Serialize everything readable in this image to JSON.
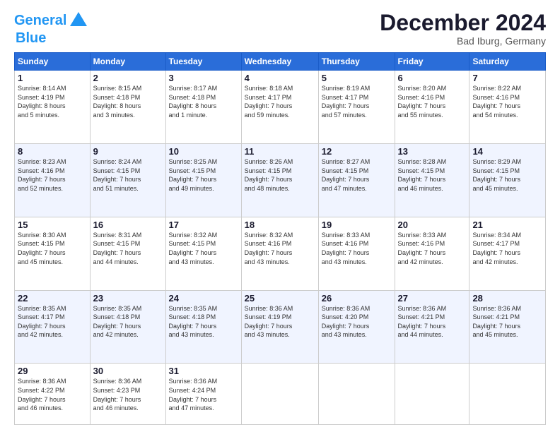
{
  "logo": {
    "line1": "General",
    "line2": "Blue"
  },
  "title": "December 2024",
  "subtitle": "Bad Iburg, Germany",
  "days_of_week": [
    "Sunday",
    "Monday",
    "Tuesday",
    "Wednesday",
    "Thursday",
    "Friday",
    "Saturday"
  ],
  "weeks": [
    [
      {
        "day": "1",
        "sunrise": "8:14 AM",
        "sunset": "4:19 PM",
        "daylight": "8 hours and 5 minutes."
      },
      {
        "day": "2",
        "sunrise": "8:15 AM",
        "sunset": "4:18 PM",
        "daylight": "8 hours and 3 minutes."
      },
      {
        "day": "3",
        "sunrise": "8:17 AM",
        "sunset": "4:18 PM",
        "daylight": "8 hours and 1 minute."
      },
      {
        "day": "4",
        "sunrise": "8:18 AM",
        "sunset": "4:17 PM",
        "daylight": "7 hours and 59 minutes."
      },
      {
        "day": "5",
        "sunrise": "8:19 AM",
        "sunset": "4:17 PM",
        "daylight": "7 hours and 57 minutes."
      },
      {
        "day": "6",
        "sunrise": "8:20 AM",
        "sunset": "4:16 PM",
        "daylight": "7 hours and 55 minutes."
      },
      {
        "day": "7",
        "sunrise": "8:22 AM",
        "sunset": "4:16 PM",
        "daylight": "7 hours and 54 minutes."
      }
    ],
    [
      {
        "day": "8",
        "sunrise": "8:23 AM",
        "sunset": "4:16 PM",
        "daylight": "7 hours and 52 minutes."
      },
      {
        "day": "9",
        "sunrise": "8:24 AM",
        "sunset": "4:15 PM",
        "daylight": "7 hours and 51 minutes."
      },
      {
        "day": "10",
        "sunrise": "8:25 AM",
        "sunset": "4:15 PM",
        "daylight": "7 hours and 49 minutes."
      },
      {
        "day": "11",
        "sunrise": "8:26 AM",
        "sunset": "4:15 PM",
        "daylight": "7 hours and 48 minutes."
      },
      {
        "day": "12",
        "sunrise": "8:27 AM",
        "sunset": "4:15 PM",
        "daylight": "7 hours and 47 minutes."
      },
      {
        "day": "13",
        "sunrise": "8:28 AM",
        "sunset": "4:15 PM",
        "daylight": "7 hours and 46 minutes."
      },
      {
        "day": "14",
        "sunrise": "8:29 AM",
        "sunset": "4:15 PM",
        "daylight": "7 hours and 45 minutes."
      }
    ],
    [
      {
        "day": "15",
        "sunrise": "8:30 AM",
        "sunset": "4:15 PM",
        "daylight": "7 hours and 45 minutes."
      },
      {
        "day": "16",
        "sunrise": "8:31 AM",
        "sunset": "4:15 PM",
        "daylight": "7 hours and 44 minutes."
      },
      {
        "day": "17",
        "sunrise": "8:32 AM",
        "sunset": "4:15 PM",
        "daylight": "7 hours and 43 minutes."
      },
      {
        "day": "18",
        "sunrise": "8:32 AM",
        "sunset": "4:16 PM",
        "daylight": "7 hours and 43 minutes."
      },
      {
        "day": "19",
        "sunrise": "8:33 AM",
        "sunset": "4:16 PM",
        "daylight": "7 hours and 43 minutes."
      },
      {
        "day": "20",
        "sunrise": "8:33 AM",
        "sunset": "4:16 PM",
        "daylight": "7 hours and 42 minutes."
      },
      {
        "day": "21",
        "sunrise": "8:34 AM",
        "sunset": "4:17 PM",
        "daylight": "7 hours and 42 minutes."
      }
    ],
    [
      {
        "day": "22",
        "sunrise": "8:35 AM",
        "sunset": "4:17 PM",
        "daylight": "7 hours and 42 minutes."
      },
      {
        "day": "23",
        "sunrise": "8:35 AM",
        "sunset": "4:18 PM",
        "daylight": "7 hours and 42 minutes."
      },
      {
        "day": "24",
        "sunrise": "8:35 AM",
        "sunset": "4:18 PM",
        "daylight": "7 hours and 43 minutes."
      },
      {
        "day": "25",
        "sunrise": "8:36 AM",
        "sunset": "4:19 PM",
        "daylight": "7 hours and 43 minutes."
      },
      {
        "day": "26",
        "sunrise": "8:36 AM",
        "sunset": "4:20 PM",
        "daylight": "7 hours and 43 minutes."
      },
      {
        "day": "27",
        "sunrise": "8:36 AM",
        "sunset": "4:21 PM",
        "daylight": "7 hours and 44 minutes."
      },
      {
        "day": "28",
        "sunrise": "8:36 AM",
        "sunset": "4:21 PM",
        "daylight": "7 hours and 45 minutes."
      }
    ],
    [
      {
        "day": "29",
        "sunrise": "8:36 AM",
        "sunset": "4:22 PM",
        "daylight": "7 hours and 46 minutes."
      },
      {
        "day": "30",
        "sunrise": "8:36 AM",
        "sunset": "4:23 PM",
        "daylight": "7 hours and 46 minutes."
      },
      {
        "day": "31",
        "sunrise": "8:36 AM",
        "sunset": "4:24 PM",
        "daylight": "7 hours and 47 minutes."
      },
      null,
      null,
      null,
      null
    ]
  ]
}
